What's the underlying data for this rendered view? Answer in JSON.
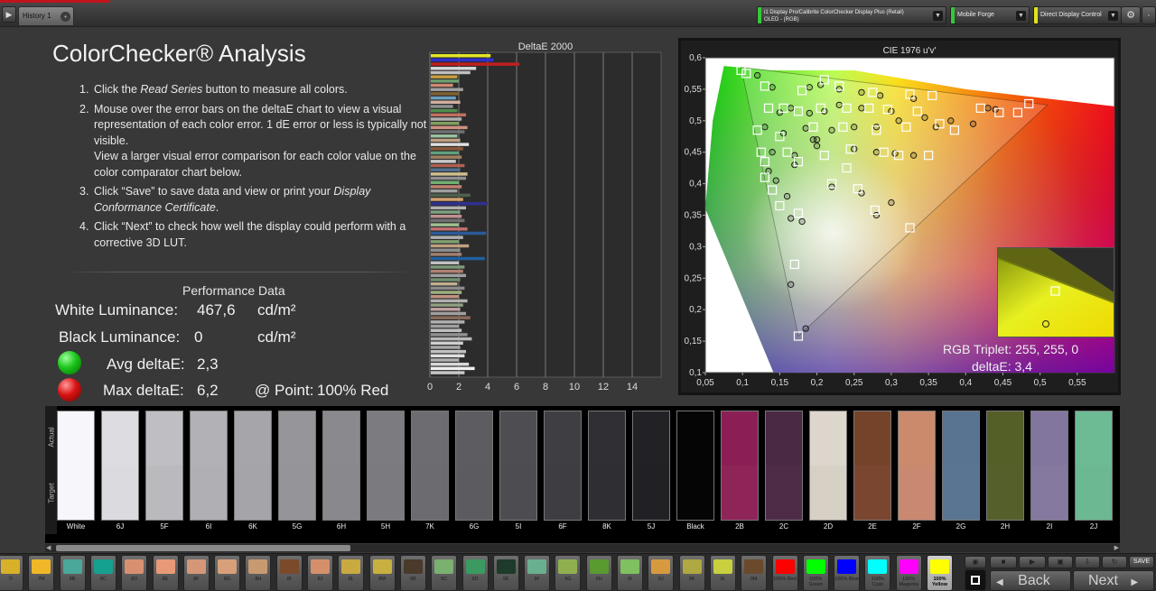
{
  "tab": {
    "label": "History 1"
  },
  "dropdowns": {
    "instrument_line1": "i1 Display Pro/Calibrite ColorChecker Display Plus (Retail)",
    "instrument_line2": "OLED - (RGB)",
    "source": "Mobile Forge",
    "control": "Direct Display Control"
  },
  "colors": {
    "green_strip": "#36c936",
    "yellow_strip": "#e3e31a",
    "red_accent": "#c0141c"
  },
  "page_title": "ColorChecker® Analysis",
  "instructions": [
    {
      "num": "1.",
      "pre": "Click the ",
      "em": "Read Series",
      "post": " button to measure all colors."
    },
    {
      "num": "2.",
      "text": "Mouse over the error bars on the deltaE chart to view a visual representation of each color error. 1 dE error or less is typically not visible.",
      "text2": "View a larger visual error comparison for each color value on the color comparator chart below."
    },
    {
      "num": "3.",
      "pre": "Click “Save” to save data and view or print your ",
      "em": "Display Conformance Certificate",
      "post": "."
    },
    {
      "num": "4.",
      "text": "Click “Next” to check how well the display could perform with a corrective 3D LUT."
    }
  ],
  "performance": {
    "title": "Performance Data",
    "white_label": "White Luminance:",
    "white_value": "467,6",
    "white_unit": "cd/m²",
    "black_label": "Black Luminance:",
    "black_value": "0",
    "black_unit": "cd/m²",
    "avg_label": "Avg deltaE:",
    "avg_value": "2,3",
    "max_label": "Max deltaE:",
    "max_value": "6,2",
    "point_label": "@ Point:",
    "point_value": "100% Red"
  },
  "chart_data": [
    {
      "type": "bar",
      "orientation": "horizontal",
      "title": "DeltaE 2000",
      "xlim": [
        0,
        16
      ],
      "xticks": [
        "0",
        "2",
        "4",
        "6",
        "8",
        "10",
        "12",
        "14"
      ],
      "values": [
        4.2,
        4.4,
        6.2,
        3.2,
        2.8,
        1.9,
        2.0,
        1.6,
        2.3,
        2.0,
        1.8,
        2.1,
        1.6,
        1.9,
        2.5,
        2.2,
        2.0,
        2.6,
        2.4,
        1.9,
        2.1,
        2.7,
        2.3,
        2.0,
        2.2,
        1.8,
        2.4,
        2.1,
        2.6,
        2.5,
        2.0,
        2.2,
        1.9,
        2.8,
        2.3,
        4.0,
        2.5,
        2.1,
        2.2,
        2.4,
        2.0,
        2.6,
        3.9,
        2.3,
        2.0,
        2.7,
        2.1,
        2.2,
        3.8,
        2.0,
        2.4,
        2.3,
        2.5,
        2.1,
        1.9,
        2.4,
        2.2,
        2.0,
        2.6,
        2.3,
        2.1,
        2.5,
        2.8,
        2.4,
        2.0,
        2.2,
        2.6,
        2.9,
        2.3,
        2.1,
        2.5,
        2.4,
        2.0,
        2.7,
        3.1,
        2.4
      ],
      "colors": [
        "#e4e428",
        "#2f2fd0",
        "#c02020",
        "#d8d8d8",
        "#bfbfbf",
        "#c9a040",
        "#6fa070",
        "#d08a70",
        "#a0a0a0",
        "#7f6030",
        "#6aa0c0",
        "#d0b0a0",
        "#909090",
        "#4f8f4f",
        "#c07060",
        "#b0b0b0",
        "#80a060",
        "#d09080",
        "#707070",
        "#9ac0a0",
        "#c0a080",
        "#e0e0e0",
        "#8a5a3a",
        "#60a080",
        "#a08060",
        "#c8c8c8",
        "#b06050",
        "#507090",
        "#d0c090",
        "#909090",
        "#70b070",
        "#c08070",
        "#a0a0a0",
        "#506050",
        "#d0a070",
        "#303090",
        "#b0b0b0",
        "#80a080",
        "#c09090",
        "#707070",
        "#a0c090",
        "#c07070",
        "#2a5a9a",
        "#b0b0b0",
        "#80a070",
        "#c0a080",
        "#909090",
        "#a08070",
        "#2060a0",
        "#c0c0c0",
        "#7a9a7a",
        "#b08070",
        "#a0a0a0",
        "#709070",
        "#c0b090",
        "#8a8a8a",
        "#a0b080",
        "#c09080",
        "#b0b0b0",
        "#90a080",
        "#c0a0a0",
        "#a0a0a0",
        "#8a6a5a",
        "#b0b0b0",
        "#a0a0a0",
        "#c0c0c0",
        "#909090",
        "#b8b8b8",
        "#d0d0d0",
        "#a8a8a8",
        "#c0c0c0",
        "#e0e0e0",
        "#b0b0b0",
        "#d8d8d8",
        "#f0f0f0",
        "#c8c8c8"
      ]
    },
    {
      "type": "scatter",
      "title": "CIE 1976 u'v'",
      "xlim": [
        0.05,
        0.6
      ],
      "ylim": [
        0.1,
        0.6
      ],
      "xticks": [
        "0,05",
        "0,1",
        "0,15",
        "0,2",
        "0,25",
        "0,3",
        "0,35",
        "0,4",
        "0,45",
        "0,5",
        "0,55"
      ],
      "yticks": [
        "0,1",
        "0,15",
        "0,2",
        "0,25",
        "0,3",
        "0,35",
        "0,4",
        "0,45",
        "0,5",
        "0,55",
        "0,6"
      ],
      "gamut": [
        [
          0.098,
          0.585
        ],
        [
          0.175,
          0.158
        ],
        [
          0.51,
          0.525
        ]
      ],
      "targets": [
        [
          0.098,
          0.58
        ],
        [
          0.175,
          0.158
        ],
        [
          0.485,
          0.527
        ],
        [
          0.13,
          0.555
        ],
        [
          0.18,
          0.548
        ],
        [
          0.21,
          0.565
        ],
        [
          0.23,
          0.555
        ],
        [
          0.275,
          0.545
        ],
        [
          0.325,
          0.542
        ],
        [
          0.355,
          0.54
        ],
        [
          0.135,
          0.52
        ],
        [
          0.155,
          0.52
        ],
        [
          0.175,
          0.515
        ],
        [
          0.205,
          0.52
        ],
        [
          0.24,
          0.52
        ],
        [
          0.27,
          0.52
        ],
        [
          0.295,
          0.518
        ],
        [
          0.335,
          0.515
        ],
        [
          0.365,
          0.495
        ],
        [
          0.42,
          0.52
        ],
        [
          0.445,
          0.513
        ],
        [
          0.47,
          0.513
        ],
        [
          0.12,
          0.485
        ],
        [
          0.15,
          0.475
        ],
        [
          0.195,
          0.49
        ],
        [
          0.235,
          0.49
        ],
        [
          0.28,
          0.485
        ],
        [
          0.32,
          0.49
        ],
        [
          0.385,
          0.485
        ],
        [
          0.125,
          0.45
        ],
        [
          0.16,
          0.45
        ],
        [
          0.21,
          0.445
        ],
        [
          0.245,
          0.455
        ],
        [
          0.29,
          0.45
        ],
        [
          0.31,
          0.445
        ],
        [
          0.35,
          0.445
        ],
        [
          0.13,
          0.435
        ],
        [
          0.175,
          0.435
        ],
        [
          0.24,
          0.425
        ],
        [
          0.13,
          0.41
        ],
        [
          0.22,
          0.4
        ],
        [
          0.255,
          0.392
        ],
        [
          0.14,
          0.39
        ],
        [
          0.15,
          0.365
        ],
        [
          0.175,
          0.353
        ],
        [
          0.278,
          0.358
        ],
        [
          0.325,
          0.33
        ],
        [
          0.17,
          0.272
        ],
        [
          0.105,
          0.575
        ]
      ],
      "measured": [
        [
          0.12,
          0.572
        ],
        [
          0.185,
          0.17
        ],
        [
          0.44,
          0.518
        ],
        [
          0.14,
          0.553
        ],
        [
          0.19,
          0.553
        ],
        [
          0.205,
          0.557
        ],
        [
          0.23,
          0.55
        ],
        [
          0.26,
          0.545
        ],
        [
          0.285,
          0.54
        ],
        [
          0.33,
          0.535
        ],
        [
          0.15,
          0.513
        ],
        [
          0.165,
          0.52
        ],
        [
          0.19,
          0.512
        ],
        [
          0.21,
          0.515
        ],
        [
          0.23,
          0.525
        ],
        [
          0.26,
          0.52
        ],
        [
          0.3,
          0.515
        ],
        [
          0.345,
          0.505
        ],
        [
          0.38,
          0.5
        ],
        [
          0.41,
          0.495
        ],
        [
          0.43,
          0.52
        ],
        [
          0.13,
          0.49
        ],
        [
          0.155,
          0.48
        ],
        [
          0.185,
          0.488
        ],
        [
          0.22,
          0.485
        ],
        [
          0.25,
          0.49
        ],
        [
          0.28,
          0.49
        ],
        [
          0.31,
          0.5
        ],
        [
          0.36,
          0.49
        ],
        [
          0.14,
          0.45
        ],
        [
          0.17,
          0.445
        ],
        [
          0.2,
          0.47
        ],
        [
          0.25,
          0.455
        ],
        [
          0.28,
          0.45
        ],
        [
          0.305,
          0.448
        ],
        [
          0.33,
          0.445
        ],
        [
          0.135,
          0.42
        ],
        [
          0.17,
          0.43
        ],
        [
          0.2,
          0.46
        ],
        [
          0.145,
          0.405
        ],
        [
          0.22,
          0.395
        ],
        [
          0.26,
          0.385
        ],
        [
          0.16,
          0.38
        ],
        [
          0.165,
          0.345
        ],
        [
          0.18,
          0.34
        ],
        [
          0.28,
          0.35
        ],
        [
          0.3,
          0.37
        ],
        [
          0.165,
          0.24
        ],
        [
          0.195,
          0.47
        ]
      ]
    }
  ],
  "inset": {
    "rgb_triplet": "RGB Triplet: 255, 255, 0",
    "delta_e": "deltaE: 3,4"
  },
  "comparator": {
    "actual_label": "Actual",
    "target_label": "Target",
    "swatches": [
      {
        "name": "White",
        "actual": "#f6f6fb",
        "target": "#f6f6fb"
      },
      {
        "name": "6J",
        "actual": "#dcdce1",
        "target": "#dadadf"
      },
      {
        "name": "5F",
        "actual": "#bebec3",
        "target": "#bababe"
      },
      {
        "name": "6I",
        "actual": "#b2b2b6",
        "target": "#b0b0b4"
      },
      {
        "name": "6K",
        "actual": "#a6a6aa",
        "target": "#a5a5a9"
      },
      {
        "name": "5G",
        "actual": "#96969a",
        "target": "#959599"
      },
      {
        "name": "6H",
        "actual": "#8a8a8e",
        "target": "#89898d"
      },
      {
        "name": "5H",
        "actual": "#7c7c80",
        "target": "#7b7b7f"
      },
      {
        "name": "7K",
        "actual": "#6d6d71",
        "target": "#6c6c70"
      },
      {
        "name": "6G",
        "actual": "#5d5d61",
        "target": "#5c5c60"
      },
      {
        "name": "5I",
        "actual": "#4e4e52",
        "target": "#4d4d51"
      },
      {
        "name": "6F",
        "actual": "#3f3f43",
        "target": "#3e3e42"
      },
      {
        "name": "8K",
        "actual": "#303034",
        "target": "#2f2f33"
      },
      {
        "name": "5J",
        "actual": "#222226",
        "target": "#212125"
      },
      {
        "name": "Black",
        "actual": "#050505",
        "target": "#050505"
      },
      {
        "name": "2B",
        "actual": "#8b1f55",
        "target": "#8e2458"
      },
      {
        "name": "2C",
        "actual": "#4a2944",
        "target": "#4e2c48"
      },
      {
        "name": "2D",
        "actual": "#dcd6cc",
        "target": "#d7d0c5"
      },
      {
        "name": "2E",
        "actual": "#75432a",
        "target": "#7a4630"
      },
      {
        "name": "2F",
        "actual": "#cc8a6c",
        "target": "#c98870"
      },
      {
        "name": "2G",
        "actual": "#587490",
        "target": "#5a7592"
      },
      {
        "name": "2H",
        "actual": "#545e27",
        "target": "#555f2b"
      },
      {
        "name": "2I",
        "actual": "#82769e",
        "target": "#85799f"
      },
      {
        "name": "2J",
        "actual": "#6dbb94",
        "target": "#6bb893"
      }
    ]
  },
  "patches": [
    {
      "label": "7I",
      "color": "#d8b02a"
    },
    {
      "label": "7M",
      "color": "#f0b828"
    },
    {
      "label": "8B",
      "color": "#4aa89a"
    },
    {
      "label": "8C",
      "color": "#16a090"
    },
    {
      "label": "8D",
      "color": "#d89070"
    },
    {
      "label": "8E",
      "color": "#e89a78"
    },
    {
      "label": "8F",
      "color": "#d49878"
    },
    {
      "label": "8G",
      "color": "#d8a07a"
    },
    {
      "label": "8H",
      "color": "#c89a70"
    },
    {
      "label": "8I",
      "color": "#7a4a2a"
    },
    {
      "label": "8J",
      "color": "#d4906a"
    },
    {
      "label": "8L",
      "color": "#c8aa40"
    },
    {
      "label": "8M",
      "color": "#c8b040"
    },
    {
      "label": "9B",
      "color": "#4a3a2a"
    },
    {
      "label": "9C",
      "color": "#7ab070"
    },
    {
      "label": "9D",
      "color": "#3a9a60"
    },
    {
      "label": "9E",
      "color": "#1e3a2a"
    },
    {
      "label": "9F",
      "color": "#6ab090"
    },
    {
      "label": "9G",
      "color": "#90b050"
    },
    {
      "label": "9H",
      "color": "#5a9a30"
    },
    {
      "label": "9I",
      "color": "#80c060"
    },
    {
      "label": "9J",
      "color": "#d89a40"
    },
    {
      "label": "9K",
      "color": "#b0a840"
    },
    {
      "label": "9L",
      "color": "#c8d040"
    },
    {
      "label": "9M",
      "color": "#6a4a2a"
    },
    {
      "label": "100% Red",
      "color": "#ff0000"
    },
    {
      "label": "100% Green",
      "color": "#00ff00"
    },
    {
      "label": "100% Blue",
      "color": "#0000ff"
    },
    {
      "label": "100% Cyan",
      "color": "#00ffff"
    },
    {
      "label": "100% Magenta",
      "color": "#ff00ff"
    },
    {
      "label": "100% Yellow",
      "color": "#ffff00"
    }
  ],
  "controls": {
    "back": "Back",
    "next": "Next",
    "save": "SAVE"
  }
}
